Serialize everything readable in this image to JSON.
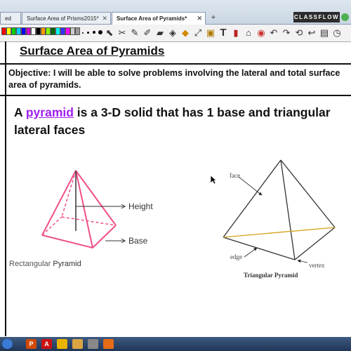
{
  "tabs": [
    {
      "label": "ed",
      "active": false
    },
    {
      "label": "Surface Area of Prisms2015*",
      "active": false
    },
    {
      "label": "Surface Area of Pyramids*",
      "active": true
    }
  ],
  "new_tab_symbol": "+",
  "brand": {
    "name": "CLASSFLOW"
  },
  "toolbar": {
    "colors": [
      "#ff0000",
      "#ffff00",
      "#00cc00",
      "#00ccff",
      "#0000ff",
      "#cc00cc",
      "#ffffff",
      "#000000",
      "#ff9900",
      "#7fff00",
      "#006600",
      "#00ffff",
      "#3333ff",
      "#ff00ff",
      "#cccccc",
      "#999999"
    ],
    "tools": [
      "select-icon",
      "tools-icon",
      "pen-icon",
      "highlighter-icon",
      "eraser-icon",
      "fill-icon",
      "shape-icon",
      "connector-icon",
      "media-icon",
      "text-icon",
      "marker-icon",
      "stamp-icon",
      "spotlight-icon",
      "undo-icon",
      "redo-icon",
      "print-icon",
      "clock-icon"
    ]
  },
  "page": {
    "title": "Surface Area of Pyramids",
    "objective": "Objective: I will be able to solve problems involving the lateral and total surface area of pyramids.",
    "definition_prefix": "A ",
    "definition_keyword": "pyramid",
    "definition_rest": " is a 3-D solid that has 1 base and triangular lateral faces"
  },
  "figure_left": {
    "height_label": "Height",
    "base_label": "Base",
    "caption_prefix": "Rectangular ",
    "caption_bold": "Pyramid"
  },
  "figure_right": {
    "face_label": "face",
    "edge_label": "edge",
    "vertex_label": "vertex",
    "caption": "Triangular Pyramid"
  },
  "taskbar": {
    "apps": [
      {
        "icon": "start-icon",
        "glyph": "",
        "color": "#3a7bd5"
      },
      {
        "icon": "powerpoint-icon",
        "glyph": "P",
        "color": "#d04a02"
      },
      {
        "icon": "acrobat-icon",
        "glyph": "A",
        "color": "#cc1111"
      },
      {
        "icon": "chrome-icon",
        "glyph": "",
        "color": "#e8b400"
      },
      {
        "icon": "folder-icon",
        "glyph": "",
        "color": "#d9a441"
      },
      {
        "icon": "media-icon",
        "glyph": "",
        "color": "#888888"
      },
      {
        "icon": "activinspire-icon",
        "glyph": "",
        "color": "#e56b17"
      }
    ]
  }
}
